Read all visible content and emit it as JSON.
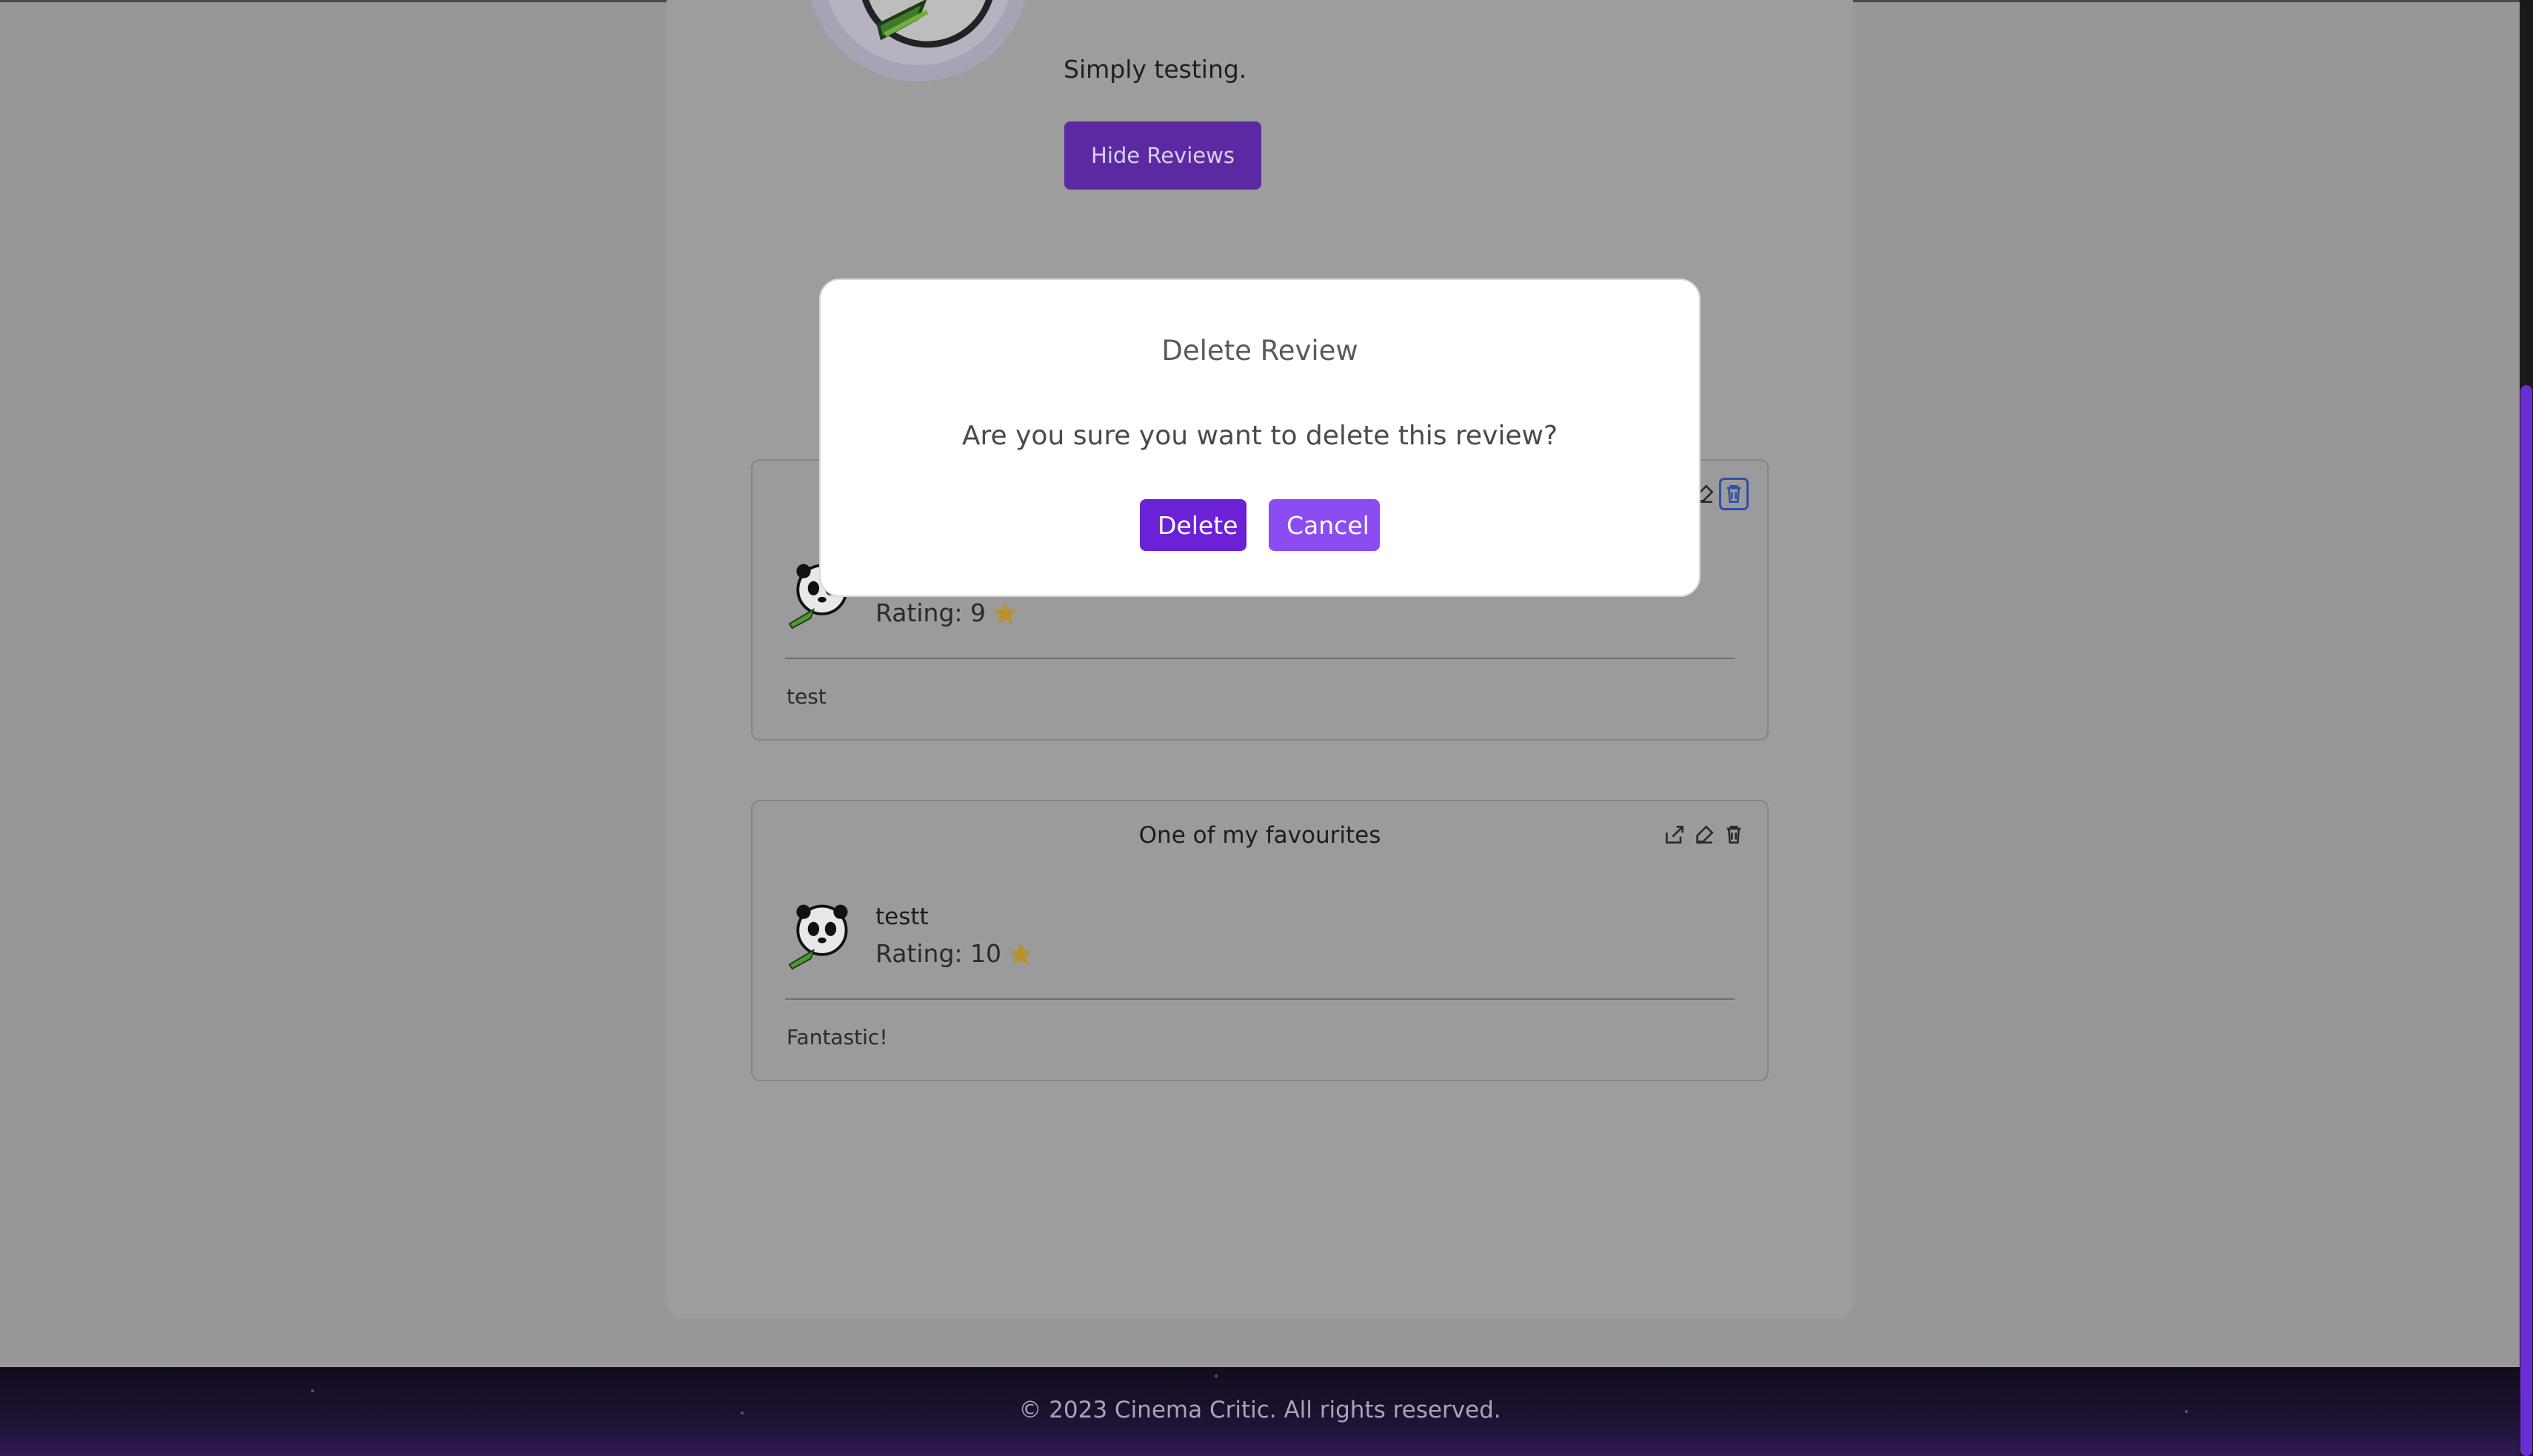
{
  "profile": {
    "bio": "Simply testing.",
    "hide_reviews_label": "Hide Reviews"
  },
  "reviews": [
    {
      "title": "",
      "reviewer": "",
      "rating_label": "Rating: 9",
      "body": "test"
    },
    {
      "title": "One of my favourites",
      "reviewer": "testt",
      "rating_label": "Rating: 10",
      "body": "Fantastic!"
    }
  ],
  "modal": {
    "title": "Delete Review",
    "message": "Are you sure you want to delete this review?",
    "delete_label": "Delete",
    "cancel_label": "Cancel"
  },
  "footer": {
    "copyright": "© 2023 Cinema Critic. All rights reserved."
  },
  "colors": {
    "accent": "#6b21d6",
    "accent_light": "#8b4cf2",
    "star": "#c9a227"
  }
}
